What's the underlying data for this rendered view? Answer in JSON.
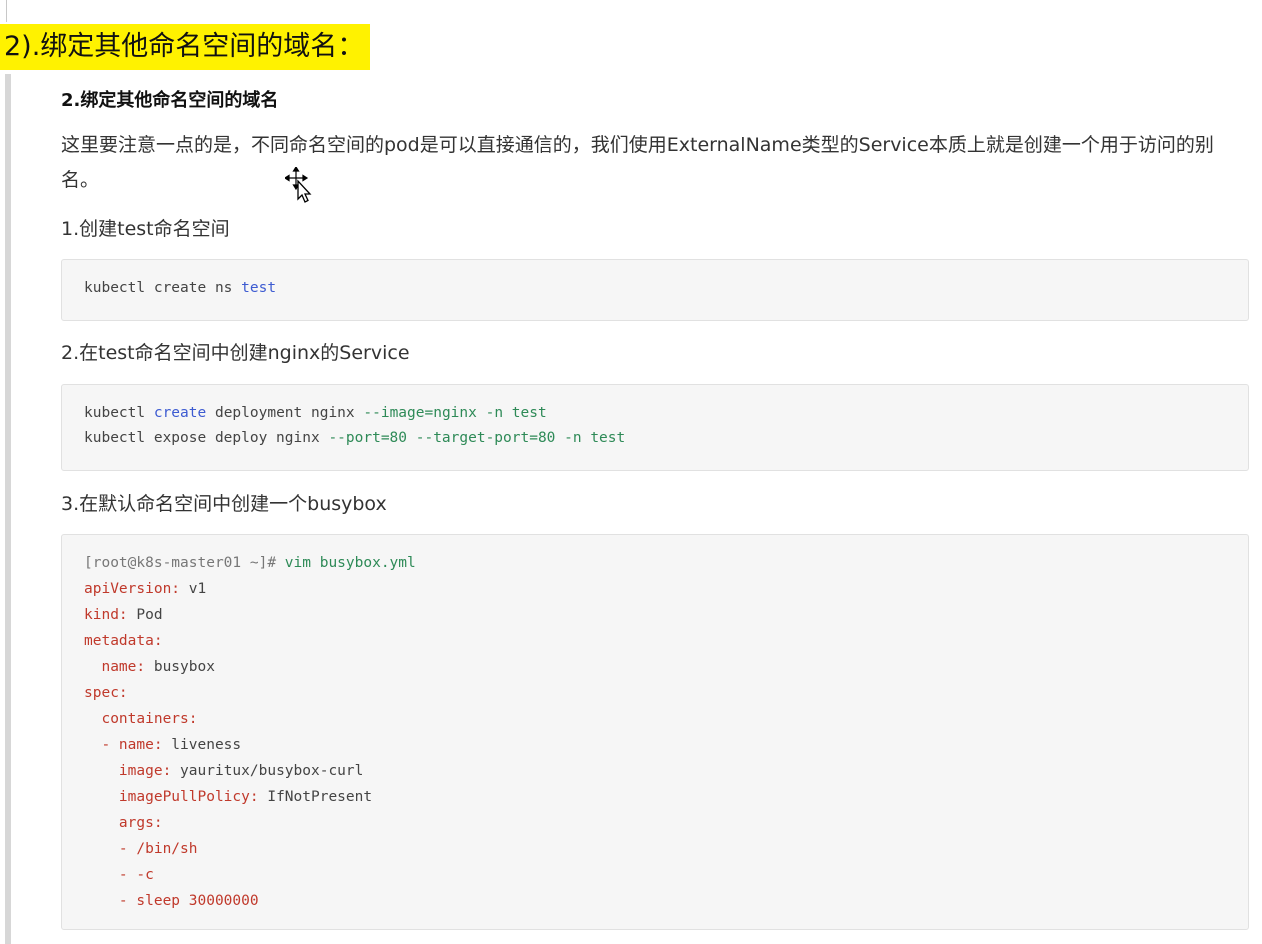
{
  "heading": {
    "text": "2).绑定其他命名空间的域名："
  },
  "doc": {
    "subtitle": "2.绑定其他命名空间的域名",
    "paragraph": "这里要注意一点的是，不同命名空间的pod是可以直接通信的，我们使用ExternalName类型的Service本质上就是创建一个用于访问的别名。",
    "step1": {
      "label": "1.创建test命名空间",
      "code": {
        "a": "kubectl create ns ",
        "b": "test"
      }
    },
    "step2": {
      "label": "2.在test命名空间中创建nginx的Service",
      "line1": {
        "a": "kubectl ",
        "b": "create",
        "c": " deployment nginx ",
        "d": "--image=nginx -n test"
      },
      "line2": {
        "a": "kubectl expose deploy nginx ",
        "b": "--port=80 --target-port=80 -n test"
      }
    },
    "step3": {
      "label": "3.在默认命名空间中创建一个busybox",
      "prompt": "[root@k8s-master01 ~]# ",
      "command": "vim busybox.yml",
      "yaml": [
        {
          "key": "apiVersion:",
          "val": " v1"
        },
        {
          "key": "kind:",
          "val": " Pod"
        },
        {
          "key": "metadata:",
          "val": ""
        },
        {
          "key": "  name:",
          "val": " busybox"
        },
        {
          "key": "spec:",
          "val": ""
        },
        {
          "key": "  containers:",
          "val": ""
        },
        {
          "key": "  - name:",
          "val": " liveness"
        },
        {
          "key": "    image:",
          "val": " yauritux/busybox-curl"
        },
        {
          "key": "    imagePullPolicy:",
          "val": " IfNotPresent"
        },
        {
          "key": "    args:",
          "val": ""
        },
        {
          "key": "    - /bin/sh",
          "val": ""
        },
        {
          "key": "    - -c",
          "val": ""
        },
        {
          "key": "    - sleep 30000000",
          "val": ""
        }
      ]
    }
  },
  "icons": {
    "cursor": "move-cursor-icon"
  }
}
